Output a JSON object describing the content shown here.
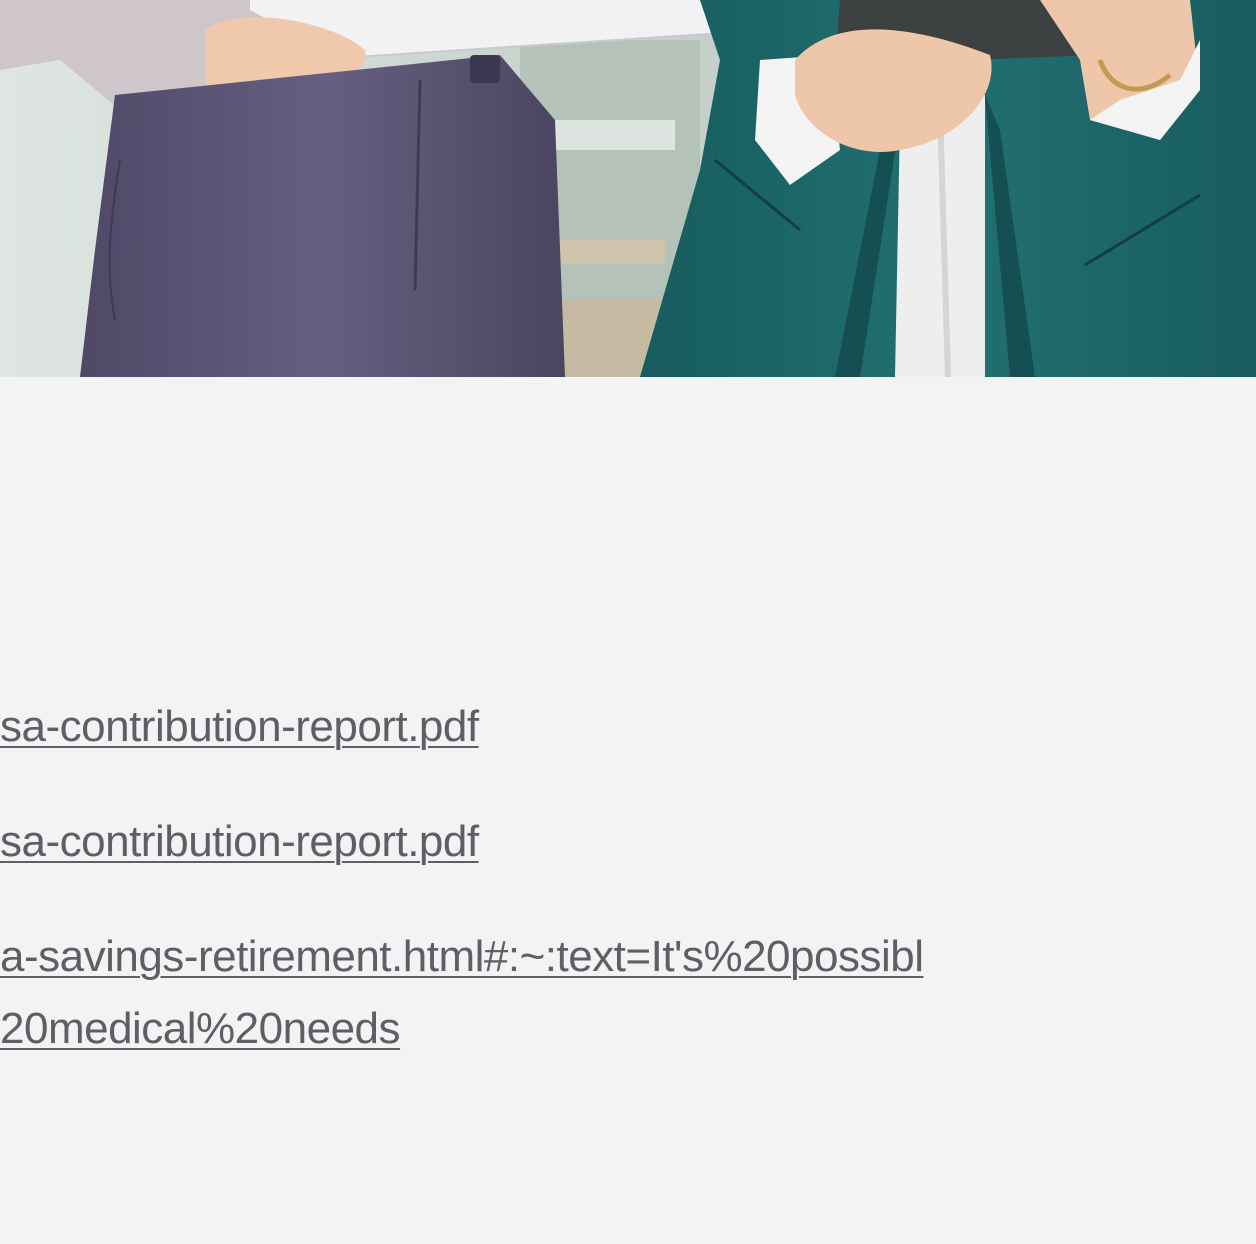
{
  "hero": {
    "image_label": "hero-photo"
  },
  "references": {
    "links": [
      {
        "line1": "sa-contribution-report.pdf"
      },
      {
        "line1": "sa-contribution-report.pdf"
      },
      {
        "line1": "a-savings-retirement.html#:~:text=It's%20possibl",
        "line2": "20medical%20needs"
      }
    ]
  },
  "colors": {
    "background": "#f2f3f5",
    "link_text": "#5f5f63",
    "trousers": "#5b5474",
    "blazer": "#1f6a6b"
  }
}
